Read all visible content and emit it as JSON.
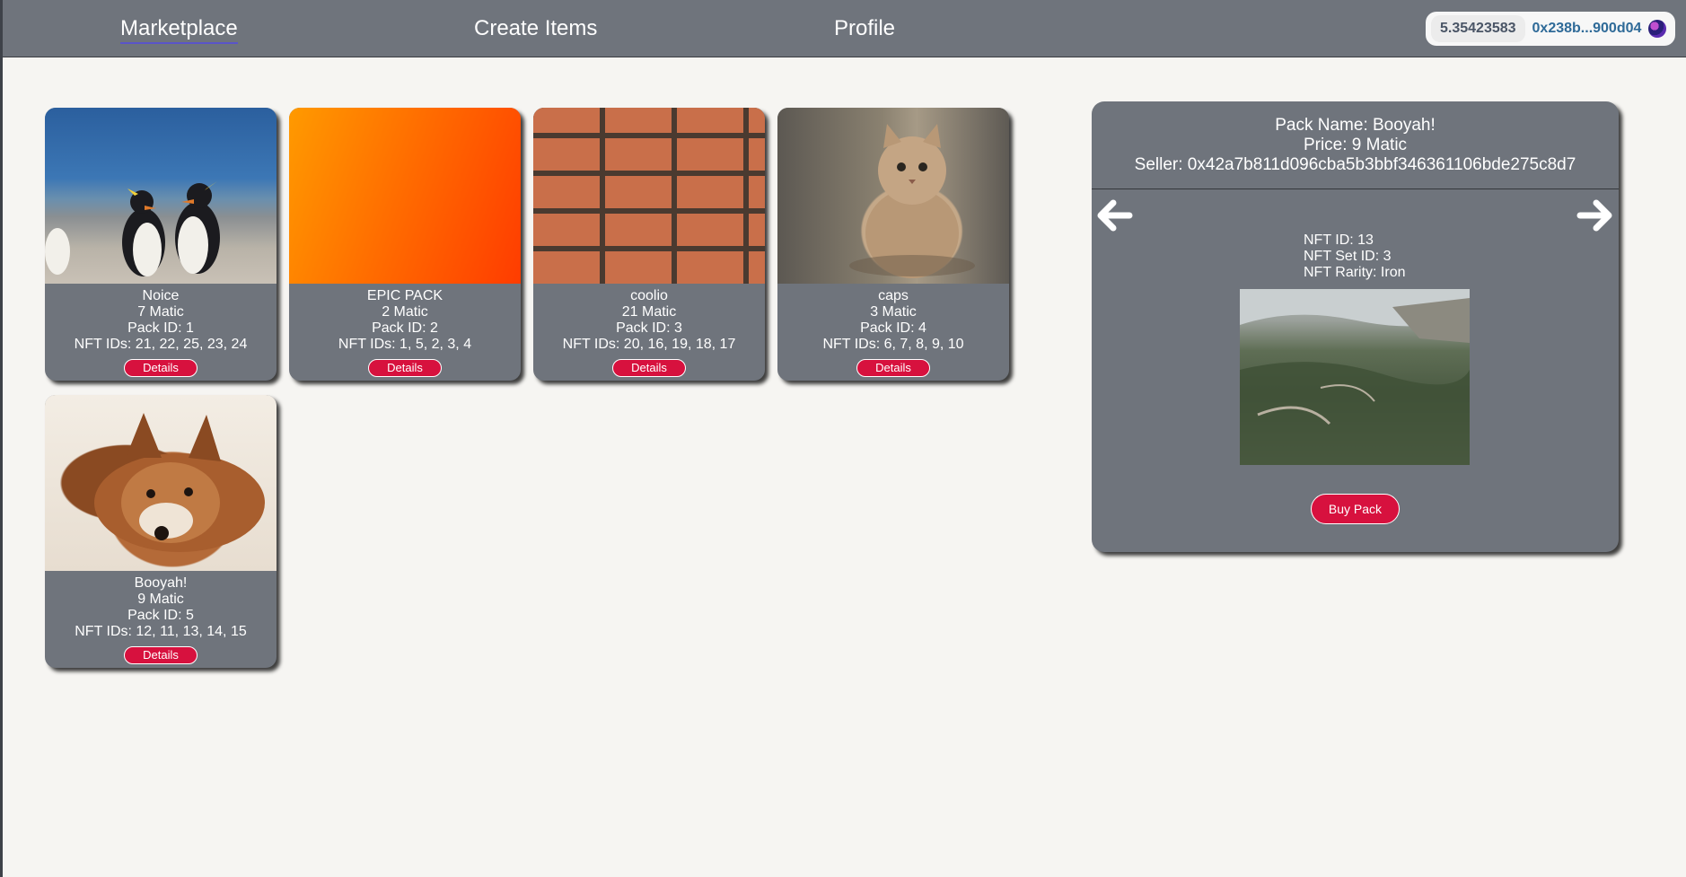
{
  "nav": {
    "marketplace": "Marketplace",
    "create_items": "Create Items",
    "profile": "Profile"
  },
  "wallet": {
    "balance": "5.35423583",
    "address": "0x238b...900d04"
  },
  "packs": [
    {
      "name": "Noice",
      "price": "7 Matic",
      "pack_id": "Pack ID: 1",
      "nft_ids": "NFT IDs: 21, 22, 25, 23, 24",
      "image": "penguins"
    },
    {
      "name": "EPIC PACK",
      "price": "2 Matic",
      "pack_id": "Pack ID: 2",
      "nft_ids": "NFT IDs: 1, 5, 2, 3, 4",
      "image": "orange-gradient"
    },
    {
      "name": "coolio",
      "price": "21 Matic",
      "pack_id": "Pack ID: 3",
      "nft_ids": "NFT IDs: 20, 16, 19, 18, 17",
      "image": "brick-wall"
    },
    {
      "name": "caps",
      "price": "3 Matic",
      "pack_id": "Pack ID: 4",
      "nft_ids": "NFT IDs: 6, 7, 8, 9, 10",
      "image": "cat"
    },
    {
      "name": "Booyah!",
      "price": "9 Matic",
      "pack_id": "Pack ID: 5",
      "nft_ids": "NFT IDs: 12, 11, 13, 14, 15",
      "image": "dog"
    }
  ],
  "details_label": "Details",
  "detail": {
    "pack_name": "Pack Name: Booyah!",
    "price": "Price: 9 Matic",
    "seller": "Seller: 0x42a7b811d096cba5b3bbf346361106bde275c8d7",
    "nft_id": "NFT ID: 13",
    "nft_set_id": "NFT Set ID: 3",
    "nft_rarity": "NFT Rarity: Iron",
    "nft_image": "forest-valley",
    "buy_label": "Buy Pack"
  },
  "colors": {
    "bar": "#6f747c",
    "background": "#f6f5f2",
    "accent_button": "#d7113e",
    "nav_underline": "#5a54c9",
    "address_text": "#2e6a98"
  },
  "icons": [
    "arrow-left-icon",
    "arrow-right-icon",
    "wallet-avatar-icon"
  ]
}
